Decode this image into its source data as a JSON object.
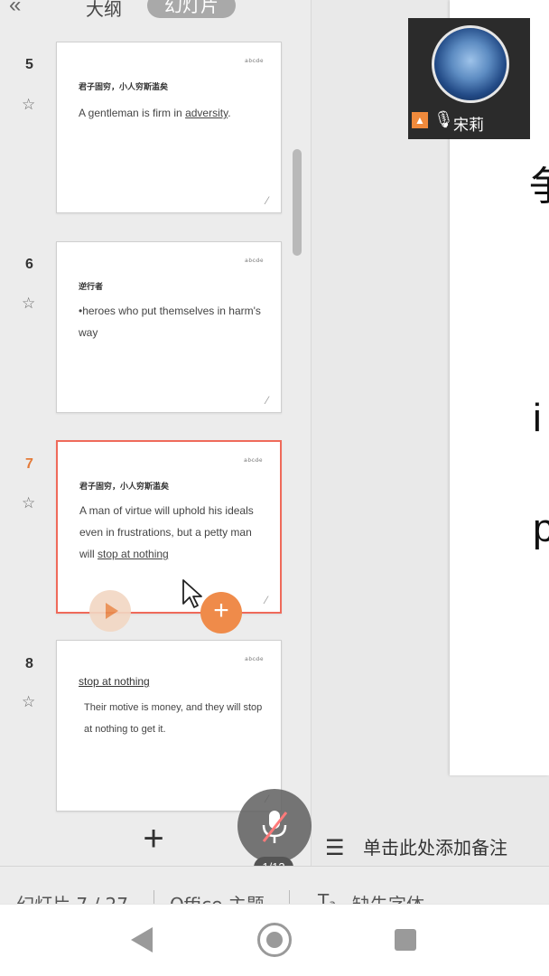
{
  "tabs": {
    "collapse": "«",
    "outline": "大纲",
    "slides": "幻灯片"
  },
  "slides": [
    {
      "number": "5",
      "tiny_header": "a·b·c·d·e",
      "heading": "君子固穷，小人穷斯滥矣",
      "body_pre": "A gentleman is firm in ",
      "body_underlined": "adversity",
      "body_post": "."
    },
    {
      "number": "6",
      "tiny_header": "a·b·c·d·e",
      "heading": "逆行者",
      "body": "•heroes who put themselves in harm's way"
    },
    {
      "number": "7",
      "active": true,
      "tiny_header": "a·b·c·d·e",
      "heading": "君子固穷，小人穷斯滥矣",
      "body_pre": "A man of virtue will uphold his ideals even in frustrations, but a petty man will ",
      "body_underlined": "stop at nothing"
    },
    {
      "number": "8",
      "tiny_header": "a·b·c·d·e",
      "heading": "stop at nothing",
      "body": "Their motive is money, and they will stop at nothing to get it."
    }
  ],
  "sidebar_actions": {
    "add": "+"
  },
  "canvas_chars": [
    "争",
    "i",
    "p"
  ],
  "video": {
    "presenter_name": "宋莉"
  },
  "notes": {
    "placeholder": "单击此处添加备注"
  },
  "mic": {
    "page_counter": "1/13"
  },
  "statusbar": {
    "slide_info": "幻灯片 7 / 27",
    "theme": "Office 主题",
    "missing_fonts": "缺失字体"
  },
  "colors": {
    "accent": "#ef8b4a",
    "active_border": "#ef6a5a",
    "mic_slash": "#ff7a7a"
  },
  "icons": [
    "star-icon",
    "play-icon",
    "add-icon",
    "cursor-icon",
    "mic-muted-icon",
    "notes-icon",
    "font-icon",
    "back-icon",
    "home-icon",
    "recents-icon"
  ]
}
